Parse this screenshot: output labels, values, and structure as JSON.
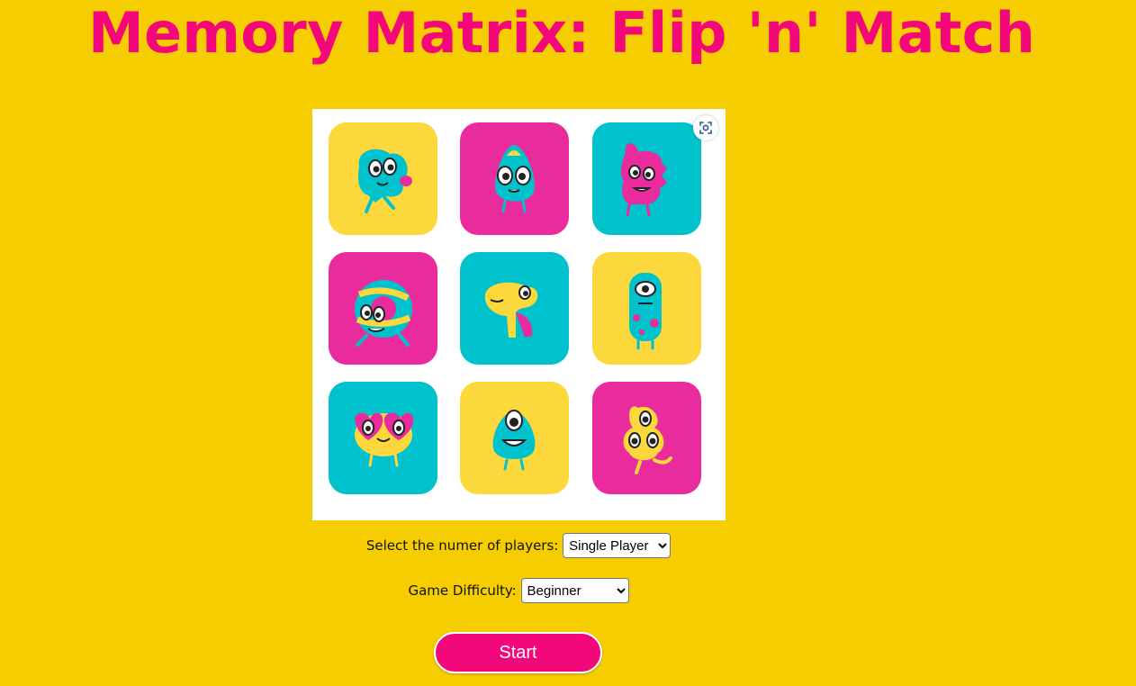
{
  "page": {
    "title": "Memory Matrix: Flip 'n' Match"
  },
  "preview": {
    "visual_search_icon": "visual-search-icon",
    "cards": [
      {
        "color": "#fdd83c",
        "creature": "teal-blob-monster"
      },
      {
        "color": "#e92b9e",
        "creature": "teal-egg-monster"
      },
      {
        "color": "#00c2cc",
        "creature": "pink-spiky-monster"
      },
      {
        "color": "#e92b9e",
        "creature": "striped-ring-monster"
      },
      {
        "color": "#00c2cc",
        "creature": "yellow-duck-monster"
      },
      {
        "color": "#fdd83c",
        "creature": "teal-cyclops-monster"
      },
      {
        "color": "#00c2cc",
        "creature": "yellow-heart-eyes-monster"
      },
      {
        "color": "#fdd83c",
        "creature": "teal-cyclops-triangle-monster"
      },
      {
        "color": "#e92b9e",
        "creature": "yellow-three-eyed-monster"
      }
    ]
  },
  "settings": {
    "players_label": "Select the numer of players:",
    "players_value": "Single Player",
    "difficulty_label": "Game Difficulty:",
    "difficulty_value": "Beginner"
  },
  "actions": {
    "start_label": "Start"
  },
  "colors": {
    "background": "#f5cd00",
    "title": "#f2087a",
    "button": "#f2087a",
    "card_yellow": "#fdd83c",
    "card_pink": "#e92b9e",
    "card_teal": "#00c2cc"
  }
}
